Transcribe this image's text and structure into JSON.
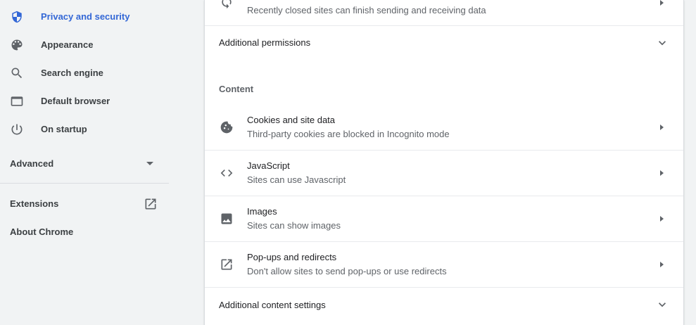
{
  "sidebar": {
    "items": [
      {
        "label": "Privacy and security",
        "icon": "shield-icon",
        "active": true
      },
      {
        "label": "Appearance",
        "icon": "palette-icon",
        "active": false
      },
      {
        "label": "Search engine",
        "icon": "search-icon",
        "active": false
      },
      {
        "label": "Default browser",
        "icon": "browser-window-icon",
        "active": false
      },
      {
        "label": "On startup",
        "icon": "power-icon",
        "active": false
      }
    ],
    "advanced_label": "Advanced",
    "extensions_label": "Extensions",
    "about_label": "About Chrome"
  },
  "main": {
    "top_partial": {
      "subtitle": "Recently closed sites can finish sending and receiving data",
      "icon": "sync-icon"
    },
    "additional_permissions_label": "Additional permissions",
    "content_section_header": "Content",
    "content_rows": [
      {
        "title": "Cookies and site data",
        "subtitle": "Third-party cookies are blocked in Incognito mode",
        "icon": "cookie-icon"
      },
      {
        "title": "JavaScript",
        "subtitle": "Sites can use Javascript",
        "icon": "code-icon"
      },
      {
        "title": "Images",
        "subtitle": "Sites can show images",
        "icon": "image-icon"
      },
      {
        "title": "Pop-ups and redirects",
        "subtitle": "Don't allow sites to send pop-ups or use redirects",
        "icon": "open-in-new-icon"
      }
    ],
    "additional_content_settings_label": "Additional content settings"
  },
  "colors": {
    "accent": "#3367d6",
    "icon_grey": "#5f6368",
    "background": "#f1f3f4",
    "card": "#ffffff"
  }
}
